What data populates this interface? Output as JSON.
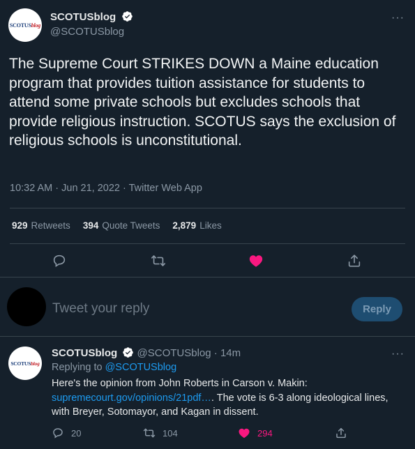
{
  "main_tweet": {
    "author_name": "SCOTUSblog",
    "author_handle": "@SCOTUSblog",
    "avatar_logo": {
      "part1": "SCOTUS",
      "part2": "blog"
    },
    "text": "The Supreme Court STRIKES DOWN a Maine education program that provides tuition assistance for students to attend some private schools but excludes schools that provide religious instruction. SCOTUS says the exclusion of religious schools is unconstitutional.",
    "meta": "10:32 AM · Jun 21, 2022 · Twitter Web App",
    "stats": {
      "retweets_count": "929",
      "retweets_label": "Retweets",
      "quotes_count": "394",
      "quotes_label": "Quote Tweets",
      "likes_count": "2,879",
      "likes_label": "Likes"
    },
    "liked": true
  },
  "reply_composer": {
    "placeholder": "Tweet your reply",
    "button_label": "Reply"
  },
  "reply_tweet": {
    "author_name": "SCOTUSblog",
    "author_handle": "@SCOTUSblog",
    "time": "· 14m",
    "avatar_logo": {
      "part1": "SCOTUS",
      "part2": "blog"
    },
    "replying_to_label": "Replying to",
    "replying_to_handle": "@SCOTUSblog",
    "line1": "Here's the opinion from John Roberts in Carson v. Makin:",
    "link": "supremecourt.gov/opinions/21pdf…",
    "line2_after_link": ". The vote is 6-3 along ideological lines,",
    "line3": "with Breyer, Sotomayor, and Kagan in dissent.",
    "replies_count": "20",
    "retweets_count": "104",
    "likes_count": "294"
  },
  "icons": [
    "verified-badge-icon",
    "more-icon",
    "reply-icon",
    "retweet-icon",
    "like-icon",
    "share-icon"
  ],
  "colors": {
    "background": "#15202b",
    "accent": "#1d9bf0",
    "like": "#f91880",
    "muted": "#8b98a5",
    "divider": "#38444d"
  }
}
